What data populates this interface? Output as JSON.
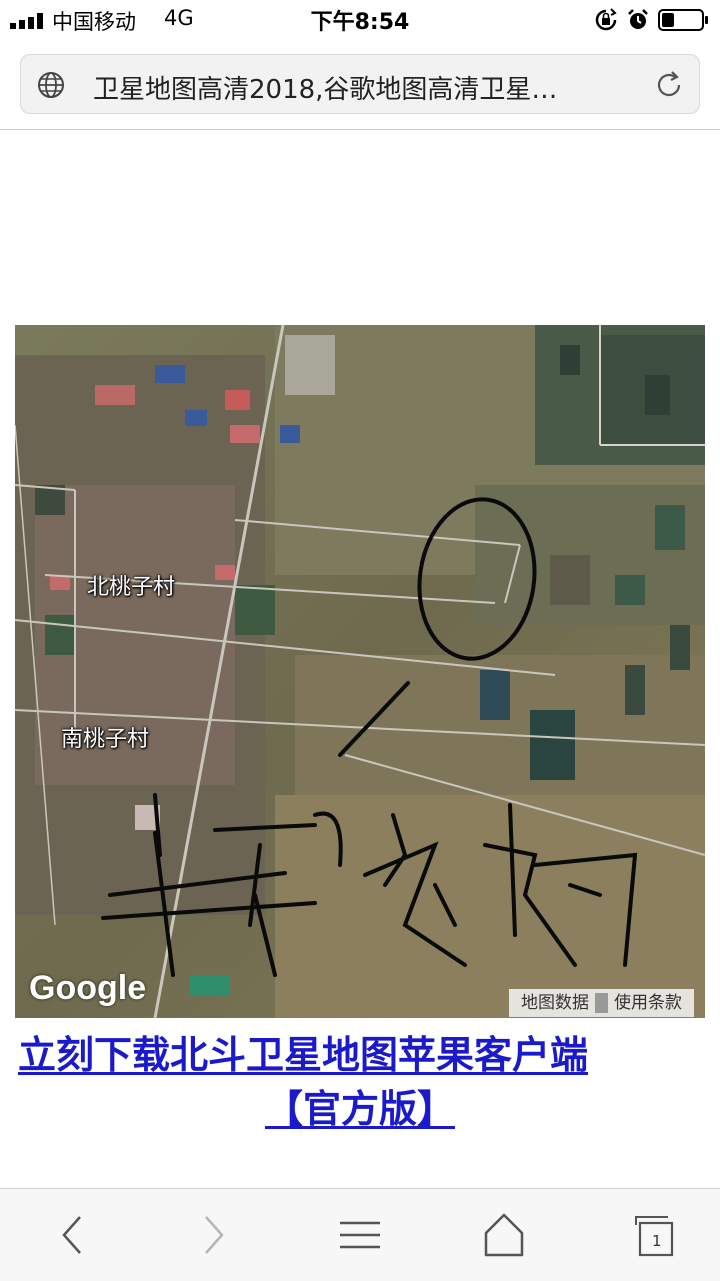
{
  "status_bar": {
    "carrier": "中国移动",
    "network": "4G",
    "time": "下午8:54"
  },
  "address_bar": {
    "title": "卫星地图高清2018,谷歌地图高清卫星…"
  },
  "map": {
    "labels": {
      "north_village": "北桃子村",
      "south_village": "南桃子村"
    },
    "logo": "Google",
    "map_data": "地图数据",
    "terms": "使用条款",
    "handwriting": "丰华农场"
  },
  "promo_link": {
    "line1": "立刻下载北斗卫星地图苹果客户端",
    "line2": "【官方版】"
  },
  "toolbar": {
    "tab_count": "1",
    "icons": [
      "back-icon",
      "forward-icon",
      "menu-icon",
      "home-icon",
      "tabs-icon"
    ]
  }
}
